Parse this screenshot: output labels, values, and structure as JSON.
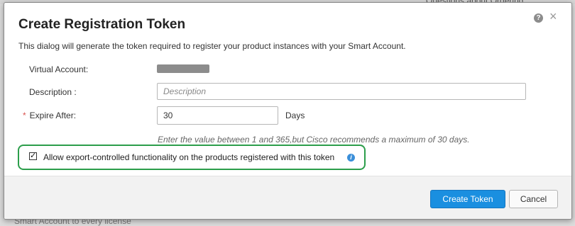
{
  "background": {
    "top_text": "Questions about Ordering",
    "bottom_text": "Smart Account to every license"
  },
  "dialog": {
    "title": "Create Registration Token",
    "intro": "This dialog will generate the token required to register your product instances with your Smart Account.",
    "help_icon": "?",
    "close_icon": "×"
  },
  "form": {
    "virtual_account_label": "Virtual Account:",
    "description_label": "Description :",
    "description_placeholder": "Description",
    "description_value": "",
    "expire_label": "Expire After:",
    "required_marker": "*",
    "expire_value": "30",
    "expire_unit": "Days",
    "expire_hint": "Enter the value between 1 and 365,but Cisco recommends a maximum of 30 days."
  },
  "export": {
    "checked": true,
    "check_glyph": "✓",
    "label": "Allow export-controlled functionality on the products registered with this token",
    "info_icon": "i"
  },
  "buttons": {
    "create": "Create Token",
    "cancel": "Cancel"
  },
  "colors": {
    "primary": "#1a8fe0",
    "highlight": "#2c9e4b",
    "required": "#d9534f",
    "info": "#3b8fd9"
  }
}
